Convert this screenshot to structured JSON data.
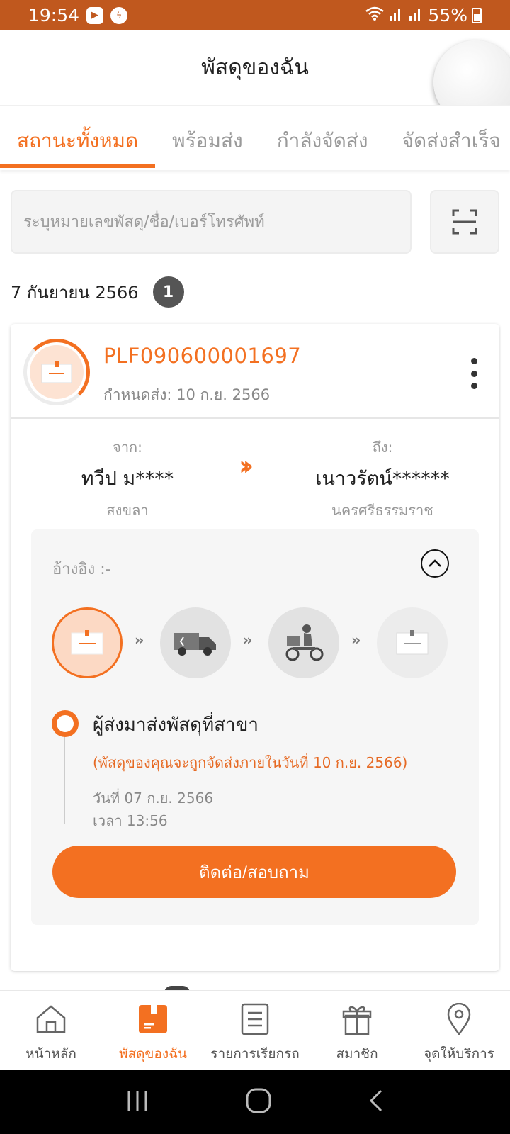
{
  "status_bar": {
    "time": "19:54",
    "battery": "55%"
  },
  "header": {
    "title": "พัสดุของฉัน"
  },
  "tabs": [
    {
      "label": "สถานะทั้งหมด",
      "active": true
    },
    {
      "label": "พร้อมส่ง",
      "active": false
    },
    {
      "label": "กำลังจัดส่ง",
      "active": false
    },
    {
      "label": "จัดส่งสำเร็จ",
      "active": false
    }
  ],
  "search": {
    "placeholder": "ระบุหมายเลขพัสดุ/ชื่อ/เบอร์โทรศัพท์"
  },
  "group": {
    "date": "7 กันยายน 2566",
    "count": "1"
  },
  "parcel": {
    "tracking_number": "PLF090600001697",
    "due_date": "กำหนดส่ง: 10 ก.ย. 2566",
    "from_label": "จาก:",
    "from_name": "ทวีป ม****",
    "from_province": "สงขลา",
    "to_label": "ถึง:",
    "to_name": "เนาวรัตน์******",
    "to_province": "นครศรีธรรมราช",
    "reference": "อ้างอิง :-",
    "status_title": "ผู้ส่งมาส่งพัสดุที่สาขา",
    "status_note": "(พัสดุของคุณจะถูกจัดส่งภายในวันที่ 10 ก.ย. 2566)",
    "status_date": "วันที่ 07 ก.ย. 2566",
    "status_time": "เวลา 13:56",
    "contact_label": "ติดต่อ/สอบถาม"
  },
  "bottom_nav": [
    {
      "label": "หน้าหลัก",
      "icon": "home-icon",
      "active": false
    },
    {
      "label": "พัสดุของฉัน",
      "icon": "parcel-icon",
      "active": true
    },
    {
      "label": "รายการเรียกรถ",
      "icon": "list-icon",
      "active": false
    },
    {
      "label": "สมาชิก",
      "icon": "gift-icon",
      "active": false
    },
    {
      "label": "จุดให้บริการ",
      "icon": "location-pin-icon",
      "active": false
    }
  ],
  "colors": {
    "accent": "#f37021",
    "status_bar": "#c0581e"
  }
}
